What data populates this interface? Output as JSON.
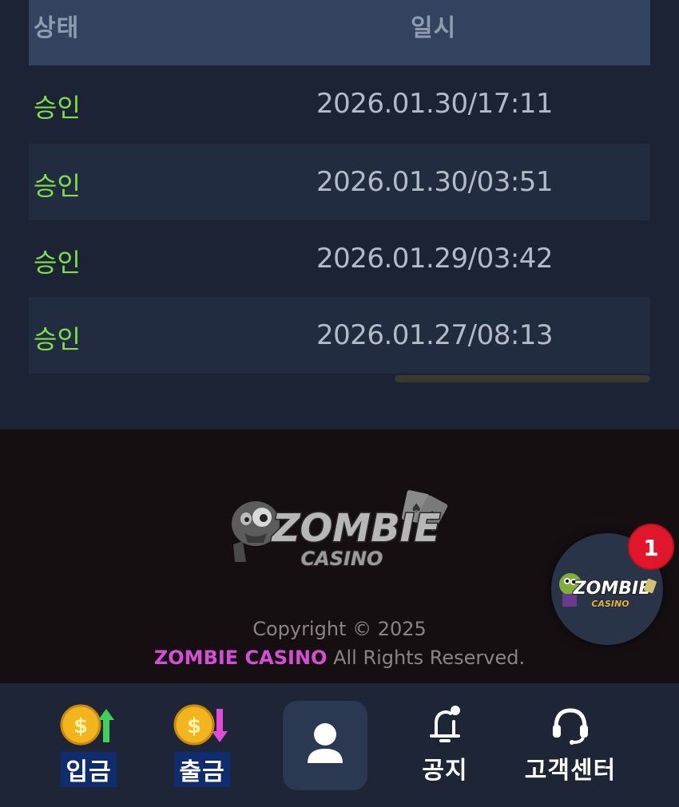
{
  "table": {
    "header": {
      "status": "상태",
      "date": "일시"
    },
    "rows": [
      {
        "status": "승인",
        "date": "2026.01.30/17:11"
      },
      {
        "status": "승인",
        "date": "2026.01.30/03:51"
      },
      {
        "status": "승인",
        "date": "2026.01.29/03:42"
      },
      {
        "status": "승인",
        "date": "2026.01.27/08:13"
      }
    ]
  },
  "footer": {
    "logo_main": "ZOMBIE",
    "logo_sub": "CASINO",
    "copyright": "Copyright © 2025",
    "brand": "ZOMBIE CASINO",
    "rights": "All Rights Reserved."
  },
  "fab": {
    "badge_count": "1",
    "logo_main": "ZOMBIE",
    "logo_sub": "CASINO"
  },
  "bottom_nav": {
    "deposit": "입금",
    "withdraw": "출금",
    "notice": "공지",
    "support": "고객센터"
  },
  "colors": {
    "approved": "#7ee04c",
    "brand": "#d54fd6",
    "badge": "#e0172a"
  }
}
